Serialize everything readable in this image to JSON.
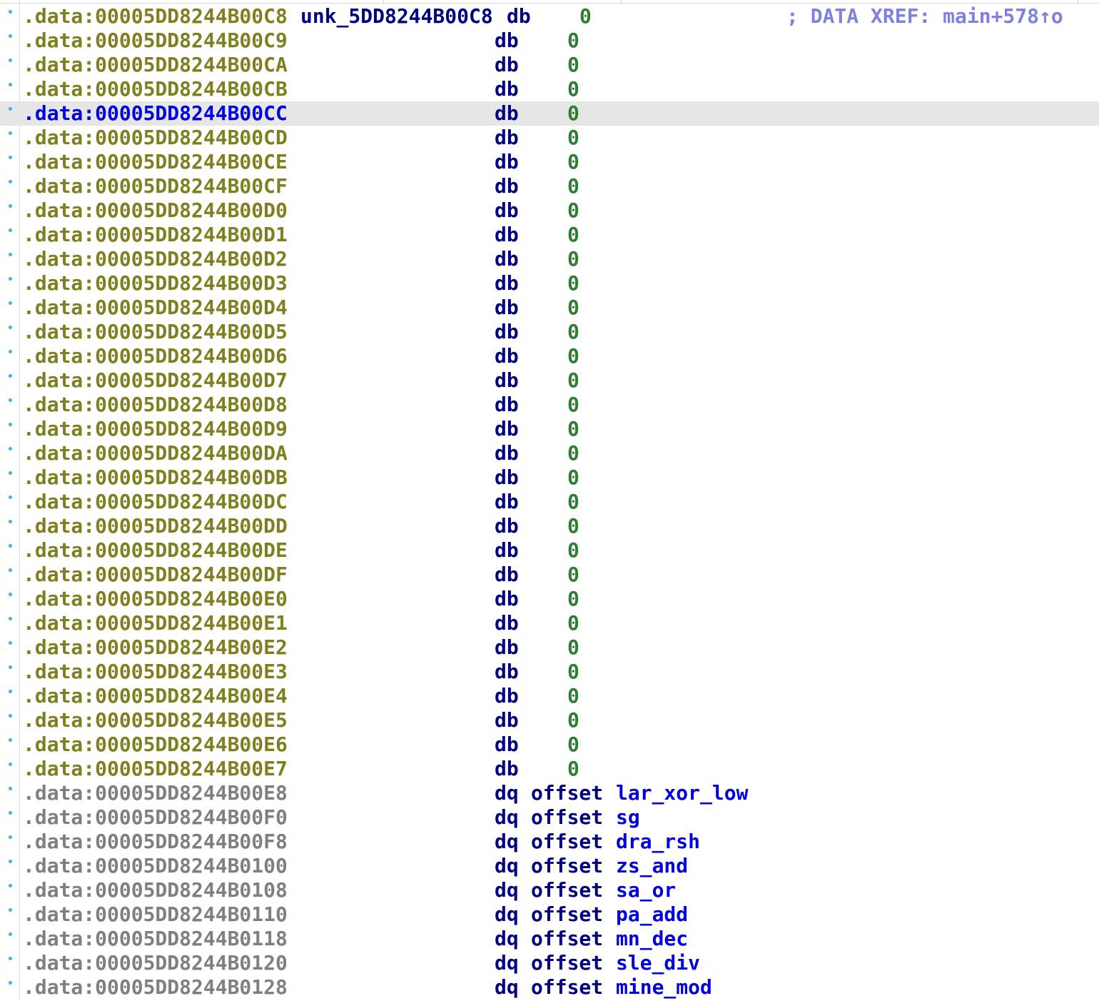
{
  "listing": {
    "header_row": {
      "address": ".data:00005DD8244B00C8",
      "label": "unk_5DD8244B00C8",
      "mnemonic": "db",
      "value": "0",
      "comment": "; DATA XREF: main+578↑o"
    },
    "db_rows": [
      {
        "address": ".data:00005DD8244B00C9",
        "mnemonic": "db",
        "value": "0"
      },
      {
        "address": ".data:00005DD8244B00CA",
        "mnemonic": "db",
        "value": "0"
      },
      {
        "address": ".data:00005DD8244B00CB",
        "mnemonic": "db",
        "value": "0"
      },
      {
        "address": ".data:00005DD8244B00CC",
        "mnemonic": "db",
        "value": "0",
        "selected": true
      },
      {
        "address": ".data:00005DD8244B00CD",
        "mnemonic": "db",
        "value": "0"
      },
      {
        "address": ".data:00005DD8244B00CE",
        "mnemonic": "db",
        "value": "0"
      },
      {
        "address": ".data:00005DD8244B00CF",
        "mnemonic": "db",
        "value": "0"
      },
      {
        "address": ".data:00005DD8244B00D0",
        "mnemonic": "db",
        "value": "0"
      },
      {
        "address": ".data:00005DD8244B00D1",
        "mnemonic": "db",
        "value": "0"
      },
      {
        "address": ".data:00005DD8244B00D2",
        "mnemonic": "db",
        "value": "0"
      },
      {
        "address": ".data:00005DD8244B00D3",
        "mnemonic": "db",
        "value": "0"
      },
      {
        "address": ".data:00005DD8244B00D4",
        "mnemonic": "db",
        "value": "0"
      },
      {
        "address": ".data:00005DD8244B00D5",
        "mnemonic": "db",
        "value": "0"
      },
      {
        "address": ".data:00005DD8244B00D6",
        "mnemonic": "db",
        "value": "0"
      },
      {
        "address": ".data:00005DD8244B00D7",
        "mnemonic": "db",
        "value": "0"
      },
      {
        "address": ".data:00005DD8244B00D8",
        "mnemonic": "db",
        "value": "0"
      },
      {
        "address": ".data:00005DD8244B00D9",
        "mnemonic": "db",
        "value": "0"
      },
      {
        "address": ".data:00005DD8244B00DA",
        "mnemonic": "db",
        "value": "0"
      },
      {
        "address": ".data:00005DD8244B00DB",
        "mnemonic": "db",
        "value": "0"
      },
      {
        "address": ".data:00005DD8244B00DC",
        "mnemonic": "db",
        "value": "0"
      },
      {
        "address": ".data:00005DD8244B00DD",
        "mnemonic": "db",
        "value": "0"
      },
      {
        "address": ".data:00005DD8244B00DE",
        "mnemonic": "db",
        "value": "0"
      },
      {
        "address": ".data:00005DD8244B00DF",
        "mnemonic": "db",
        "value": "0"
      },
      {
        "address": ".data:00005DD8244B00E0",
        "mnemonic": "db",
        "value": "0"
      },
      {
        "address": ".data:00005DD8244B00E1",
        "mnemonic": "db",
        "value": "0"
      },
      {
        "address": ".data:00005DD8244B00E2",
        "mnemonic": "db",
        "value": "0"
      },
      {
        "address": ".data:00005DD8244B00E3",
        "mnemonic": "db",
        "value": "0"
      },
      {
        "address": ".data:00005DD8244B00E4",
        "mnemonic": "db",
        "value": "0"
      },
      {
        "address": ".data:00005DD8244B00E5",
        "mnemonic": "db",
        "value": "0"
      },
      {
        "address": ".data:00005DD8244B00E6",
        "mnemonic": "db",
        "value": "0"
      },
      {
        "address": ".data:00005DD8244B00E7",
        "mnemonic": "db",
        "value": "0"
      }
    ],
    "dq_rows": [
      {
        "address": ".data:00005DD8244B00E8",
        "mnemonic": "dq",
        "keyword": "offset",
        "target": "lar_xor_low"
      },
      {
        "address": ".data:00005DD8244B00F0",
        "mnemonic": "dq",
        "keyword": "offset",
        "target": "sg"
      },
      {
        "address": ".data:00005DD8244B00F8",
        "mnemonic": "dq",
        "keyword": "offset",
        "target": "dra_rsh"
      },
      {
        "address": ".data:00005DD8244B0100",
        "mnemonic": "dq",
        "keyword": "offset",
        "target": "zs_and"
      },
      {
        "address": ".data:00005DD8244B0108",
        "mnemonic": "dq",
        "keyword": "offset",
        "target": "sa_or"
      },
      {
        "address": ".data:00005DD8244B0110",
        "mnemonic": "dq",
        "keyword": "offset",
        "target": "pa_add"
      },
      {
        "address": ".data:00005DD8244B0118",
        "mnemonic": "dq",
        "keyword": "offset",
        "target": "mn_dec"
      },
      {
        "address": ".data:00005DD8244B0120",
        "mnemonic": "dq",
        "keyword": "offset",
        "target": "sle_div"
      },
      {
        "address": ".data:00005DD8244B0128",
        "mnemonic": "dq",
        "keyword": "offset",
        "target": "mine_mod"
      }
    ]
  },
  "colors": {
    "data_address": "#7f7f1f",
    "code_address": "#7f7f7f",
    "selected_address": "#0000e6",
    "mnemonic": "#000080",
    "value": "#2e7d32",
    "offset_target": "#0000e0",
    "comment": "#8080e0",
    "selected_row_bg": "#e6e6e6",
    "gutter_dot": "#39b6e3"
  }
}
